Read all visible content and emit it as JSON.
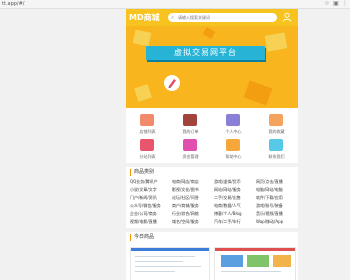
{
  "browser": {
    "url": "tt.app/#/"
  },
  "header": {
    "logo": "MD商城",
    "search_placeholder": "请输入搜索关键词"
  },
  "banner": {
    "title": "虚拟交易网平台"
  },
  "grid": [
    {
      "label": "店铺列表",
      "color": "#f28a6b"
    },
    {
      "label": "我的订单",
      "color": "#a3443c"
    },
    {
      "label": "个人中心",
      "color": "#8a7fd6"
    },
    {
      "label": "我的收藏",
      "color": "#f4a35f"
    },
    {
      "label": "分站列表",
      "color": "#e8556d"
    },
    {
      "label": "资金管理",
      "color": "#e04fb0"
    },
    {
      "label": "帮助中心",
      "color": "#f5a73b"
    },
    {
      "label": "联系我们",
      "color": "#57c9e8"
    }
  ],
  "sections": {
    "categories_title": "商品类别",
    "today_title": "今日商品"
  },
  "categories": [
    [
      "QQ业务/腾讯产",
      "电商/网店/商店",
      "游戏/虚拟/货币",
      "网页/点击/直播"
    ],
    [
      "小说/文章/文字",
      "影视/文化/图书",
      "网站/网站/服务",
      "电脑/网站/电脑"
    ],
    [
      "门户/新闻/资讯",
      "论坛/社区/问答",
      "二手/交易/出售",
      "软件/下载/应用"
    ],
    [
      "公众号/微信/服务",
      "商户/商城/服务",
      "电商/数据/人气",
      "游戏/账号/装备"
    ],
    [
      "企业/公司/商务",
      "行业/综合/网络",
      "博客/个人/Blog",
      "音乐/视频/直播"
    ],
    [
      "视频/电影/直播",
      "域名/空间/服务",
      "汽车/二手/车行",
      "Wap/移动/App"
    ]
  ]
}
